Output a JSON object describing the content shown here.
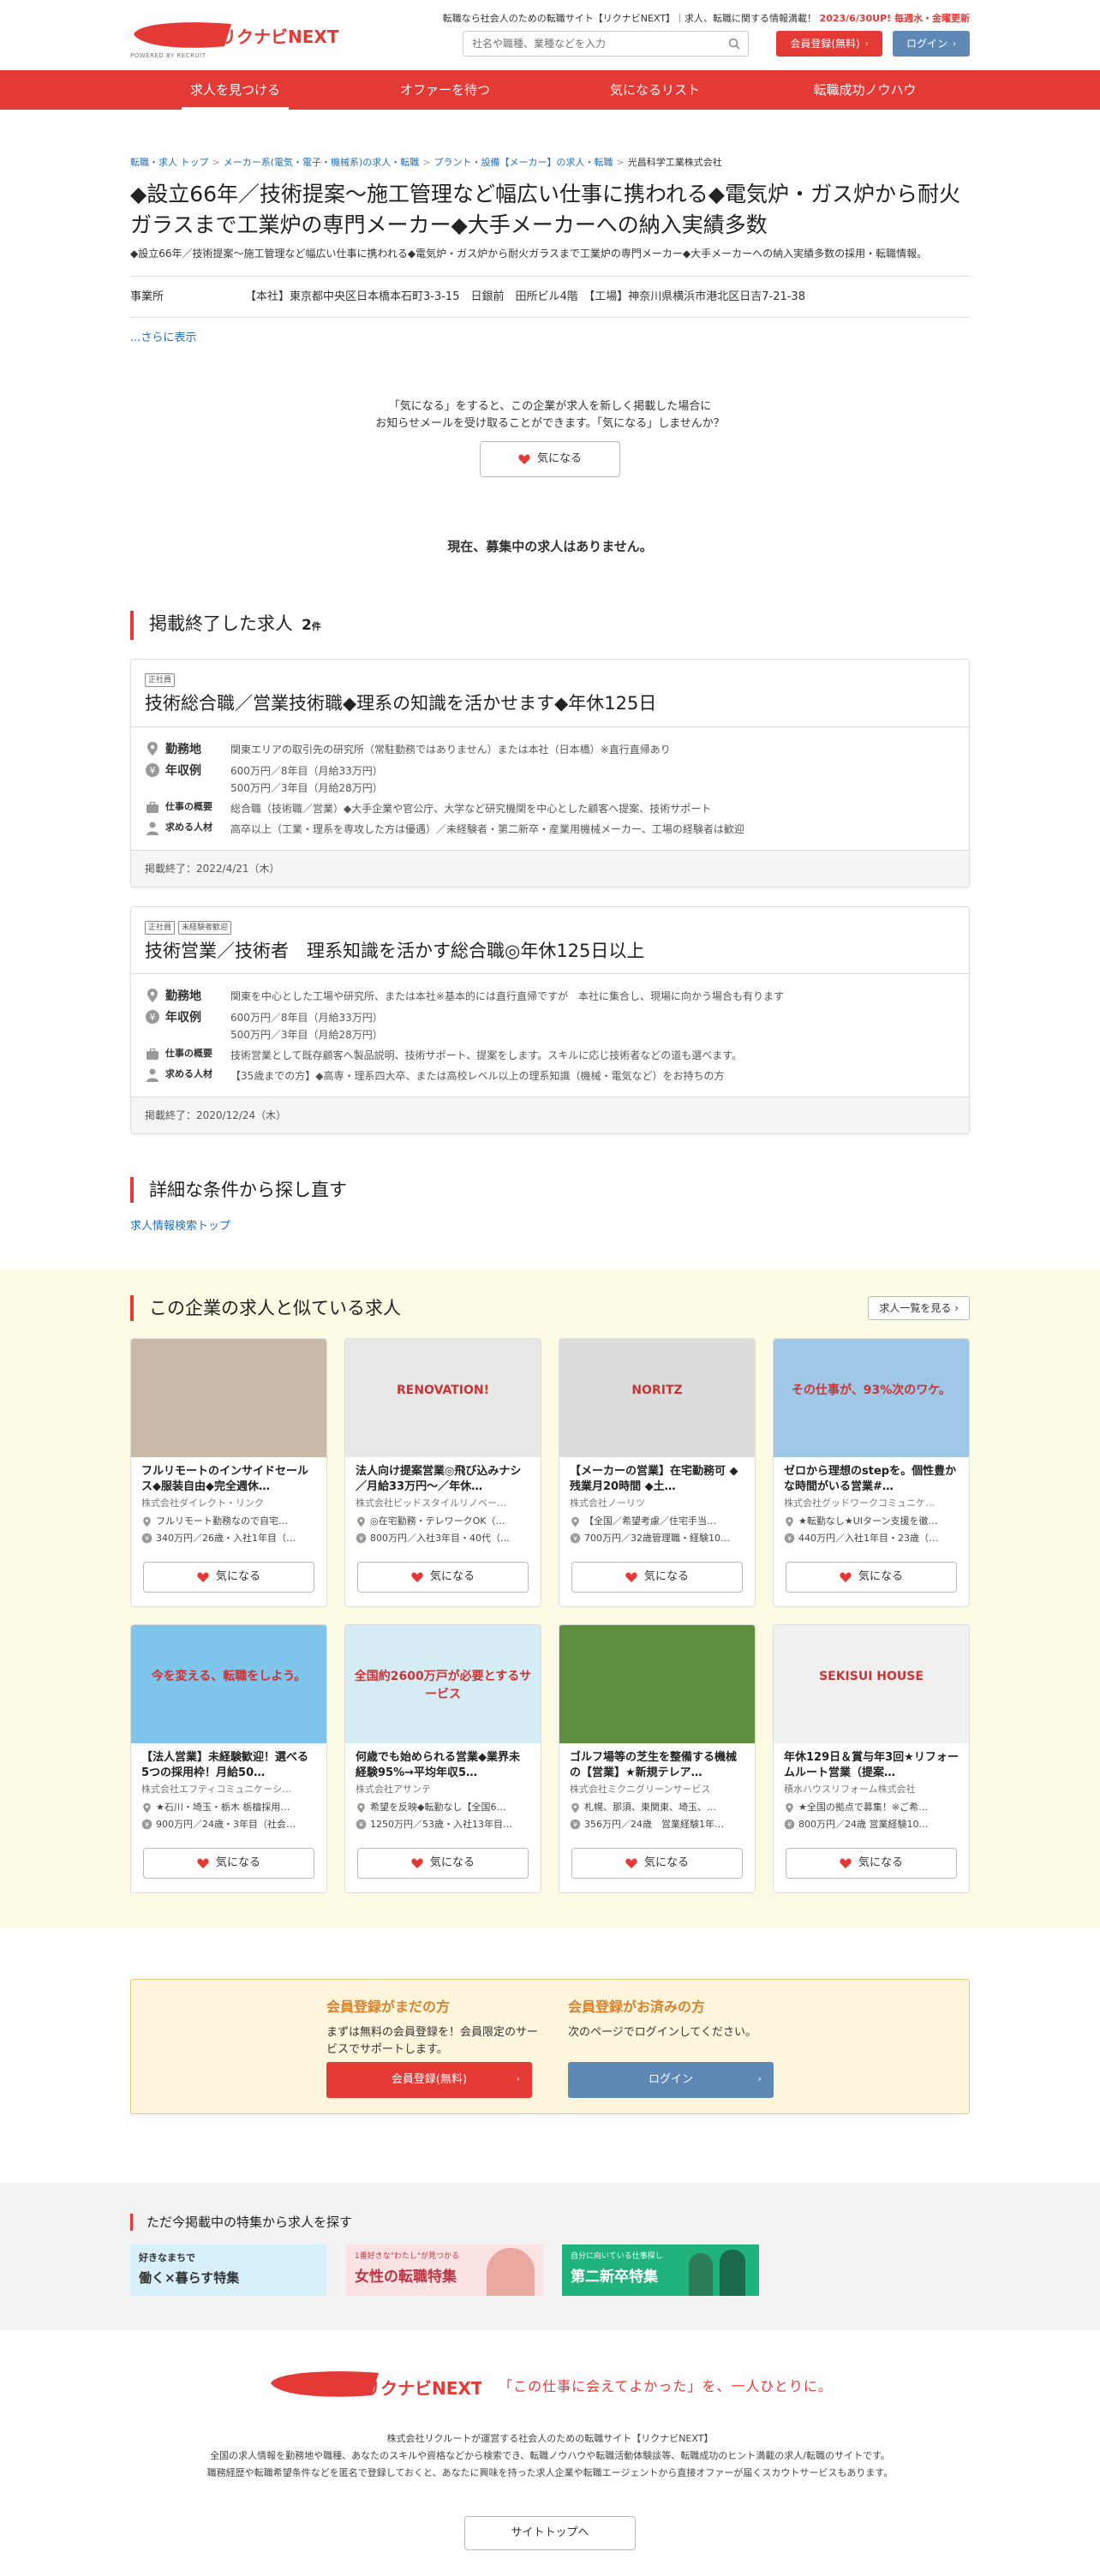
{
  "header": {
    "logo_text": "リクナビNEXT",
    "logo_caption": "POWERED BY RECRUIT",
    "tagline_prefix": "転職なら社会人のための転職サイト【リクナビNEXT】｜求人、転職に関する情報満載！",
    "tagline_highlight": "2023/6/30UP! 毎週水・金曜更新",
    "search_placeholder": "社名や職種、業種などを入力",
    "register_label": "会員登録(無料)",
    "login_label": "ログイン"
  },
  "nav": [
    "求人を見つける",
    "オファーを待つ",
    "気になるリスト",
    "転職成功ノウハウ"
  ],
  "breadcrumb": [
    "転職・求人 トップ",
    "メーカー系(電気・電子・機械系)の求人・転職",
    "プラント・設備【メーカー】の求人・転職",
    "光昌科学工業株式会社"
  ],
  "company": {
    "title": "◆設立66年／技術提案〜施工管理など幅広い仕事に携われる◆電気炉・ガス炉から耐火ガラスまで工業炉の専門メーカー◆大手メーカーへの納入実績多数",
    "subtitle": "◆設立66年／技術提案〜施工管理など幅広い仕事に携われる◆電気炉・ガス炉から耐火ガラスまで工業炉の専門メーカー◆大手メーカーへの納入実績多数の採用・転職情報。",
    "office_label": "事業所",
    "office_value": "【本社】東京都中央区日本橋本石町3-3-15　日銀前　田所ビル4階　【工場】神奈川県横浜市港北区日吉7-21-38",
    "more_label": "...さらに表示"
  },
  "follow": {
    "line1": "「気になる」をすると、この企業が求人を新しく掲載した場合に",
    "line2": "お知らせメールを受け取ることができます。「気になる」しませんか？",
    "button": "気になる"
  },
  "no_jobs": "現在、募集中の求人はありません。",
  "ended": {
    "heading": "掲載終了した求人",
    "count": "2",
    "count_unit": "件",
    "jobs": [
      {
        "tags": [
          "正社員"
        ],
        "title": "技術総合職／営業技術職◆理系の知識を活かせます◆年休125日",
        "location_label": "勤務地",
        "location": "関東エリアの取引先の研究所（常駐勤務ではありません）または本社（日本橋）※直行直帰あり",
        "salary_label": "年収例",
        "salary1": "600万円／8年目（月給33万円）",
        "salary2": "500万円／3年目（月給28万円）",
        "work_label": "仕事の概要",
        "work": "総合職（技術職／営業）◆大手企業や官公庁、大学など研究機関を中心とした顧客へ提案、技術サポート",
        "req_label": "求める人材",
        "req": "高卒以上（工業・理系を専攻した方は優遇）／未経験者・第二新卒・産業用機械メーカー、工場の経験者は歓迎",
        "ended": "掲載終了：2022/4/21（木）"
      },
      {
        "tags": [
          "正社員",
          "未経験者歓迎"
        ],
        "title": "技術営業／技術者　理系知識を活かす総合職◎年休125日以上",
        "location_label": "勤務地",
        "location": "関東を中心とした工場や研究所、または本社※基本的には直行直帰ですが　本社に集合し、現場に向かう場合も有ります",
        "salary_label": "年収例",
        "salary1": "600万円／8年目（月給33万円）",
        "salary2": "500万円／3年目（月給28万円）",
        "work_label": "仕事の概要",
        "work": "技術営業として既存顧客へ製品説明、技術サポート、提案をします。スキルに応じ技術者などの道も選べます。",
        "req_label": "求める人材",
        "req": "【35歳までの方】◆高専・理系四大卒、または高校レベル以上の理系知識（機械・電気など）をお持ちの方",
        "ended": "掲載終了：2020/12/24（木）"
      }
    ]
  },
  "research": {
    "heading": "詳細な条件から探し直す",
    "link": "求人情報検索トップ"
  },
  "similar": {
    "heading": "この企業の求人と似ている求人",
    "all_button": "求人一覧を見る",
    "fav_label": "気になる",
    "cards": [
      {
        "title": "フルリモートのインサイドセールス◆服装自由◆完全週休…",
        "company": "株式会社ダイレクト・リンク",
        "loc": "フルリモート勤務なので自宅…",
        "sal": "340万円／26歳・入社1年目（…",
        "img_text": "",
        "img_color": "#c9b9a6"
      },
      {
        "title": "法人向け提案営業◎飛び込みナシ／月給33万円〜／年休…",
        "company": "株式会社ビッドスタイルリノベー…",
        "loc": "◎在宅勤務・テレワークOK（…",
        "sal": "800万円／入社3年目・40代（…",
        "img_text": "RENOVATION!",
        "img_color": "#e8e8e8"
      },
      {
        "title": "【メーカーの営業】在宅勤務可 ◆残業月20時間 ◆土…",
        "company": "株式会社ノーリツ",
        "loc": "【全国／希望考慮／住宅手当…",
        "sal": "700万円／32歳管理職・経験10…",
        "img_text": "NORITZ",
        "img_color": "#dcdcdc"
      },
      {
        "title": "ゼロから理想のstepを。個性豊かな時間がいる営業#…",
        "company": "株式会社グッドワークコミュニケ…",
        "loc": "★転勤なし★UIターン支援を徹…",
        "sal": "440万円／入社1年目・23歳（…",
        "img_text": "その仕事が、93%次のワケ。",
        "img_color": "#9fc7e6"
      },
      {
        "title": "【法人営業】未経験歓迎！選べる5つの採用枠！月給50…",
        "company": "株式会社エフティコミュニケーシ…",
        "loc": "★石川・埼玉・栃木 栃檀採用…",
        "sal": "900万円／24歳・3年目（社会…",
        "img_text": "今を変える、転職をしよう。",
        "img_color": "#7fc4ea"
      },
      {
        "title": "何歳でも始められる営業◆業界未経験95%→平均年収5…",
        "company": "株式会社アサンテ",
        "loc": "希望を反映◆転勤なし【全国6…",
        "sal": "1250万円／53歳・入社13年目…",
        "img_text": "全国約2600万戸が必要とするサービス",
        "img_color": "#d6ecf5"
      },
      {
        "title": "ゴルフ場等の芝生を整備する機械の【営業】★新規テレア…",
        "company": "株式会社ミクニグリーンサービス",
        "loc": "札幌、那須、東関東、埼玉、…",
        "sal": "356万円／24歳　営業経験1年…",
        "img_text": "",
        "img_color": "#5f8f3e"
      },
      {
        "title": "年休129日＆賞与年3回★リフォームルート営業（提案…",
        "company": "積水ハウスリフォーム株式会社",
        "loc": "★全国の拠点で募集！※ご希…",
        "sal": "800万円／24歳 営業経験10…",
        "img_text": "SEKISUI HOUSE",
        "img_color": "#f0f0f0"
      }
    ]
  },
  "member": {
    "new_heading": "会員登録がまだの方",
    "new_text": "まずは無料の会員登録を！会員限定のサービスでサポートします。",
    "new_button": "会員登録(無料)",
    "exist_heading": "会員登録がお済みの方",
    "exist_text": "次のページでログインしてください。",
    "exist_button": "ログイン"
  },
  "features": {
    "heading": "ただ今掲載中の特集から求人を探す",
    "banners": [
      {
        "small": "好きなまちで",
        "big": "働く×暮らす特集",
        "color": "#d7f0fa"
      },
      {
        "small": "1番好きな\"わたし\"が見つかる",
        "big": "女性の転職特集",
        "color": "#fbe3e3"
      },
      {
        "small": "自分に向いている仕事探し",
        "big": "第二新卒特集",
        "color": "#20b37b"
      }
    ]
  },
  "footer": {
    "copy": "「この仕事に会えてよかった」を、一人ひとりに。",
    "line1": "株式会社リクルートが運営する社会人のための転職サイト【リクナビNEXT】",
    "line2": "全国の求人情報を勤務地や職種、あなたのスキルや資格などから検索でき、転職ノウハウや転職活動体験談等、転職成功のヒント満載の求人/転職のサイトです。",
    "line3": "職務経歴や転職希望条件などを匿名で登録しておくと、あなたに興味を持った求人企業や転職エージェントから直接オファーが届くスカウトサービスもあります。",
    "top_button": "サイトトップへ"
  },
  "colors": {
    "brand": "#e53935",
    "login": "#5e88b6",
    "member_bg": "#fdf6dc",
    "similar_bg": "#fdfbe3"
  }
}
